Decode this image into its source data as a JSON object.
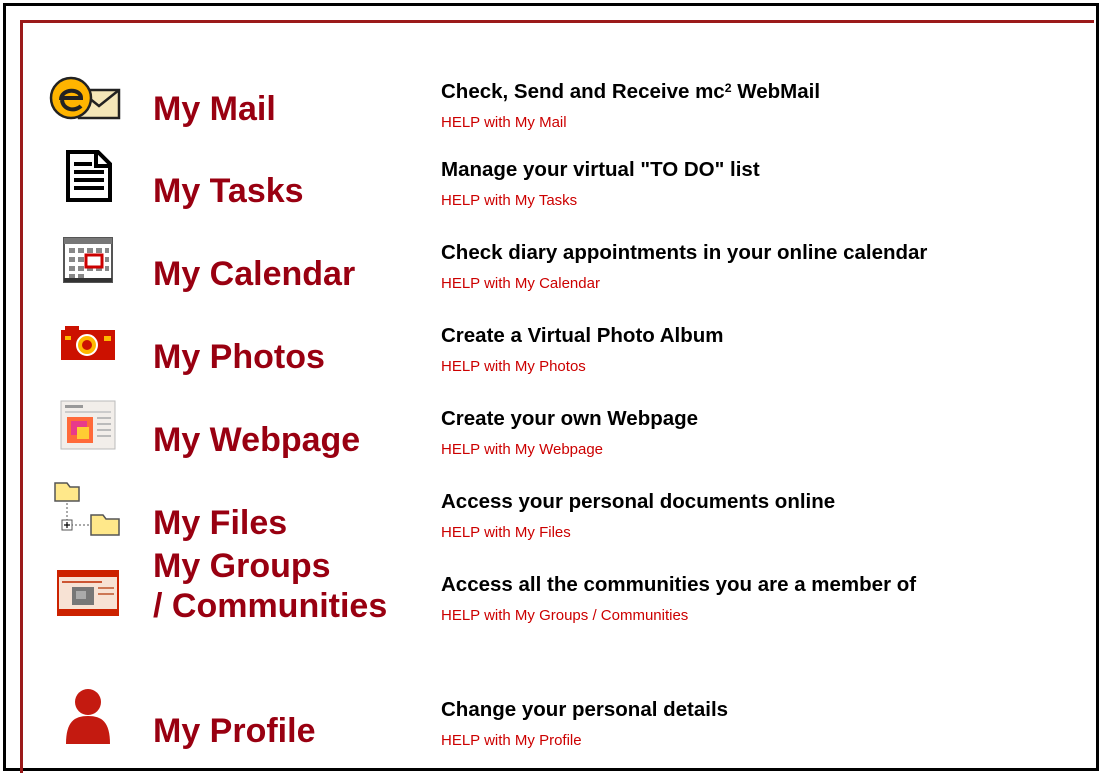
{
  "items": [
    {
      "icon": "mail-icon",
      "title": "My Mail",
      "desc": "Check, Send and Receive mc² WebMail",
      "help": "HELP with My Mail"
    },
    {
      "icon": "tasks-document-icon",
      "title": "My Tasks",
      "desc": "Manage your virtual \"TO DO\" list",
      "help": "HELP with My Tasks"
    },
    {
      "icon": "calendar-icon",
      "title": "My Calendar",
      "desc": "Check diary appointments in your online calendar",
      "help": "HELP with My Calendar"
    },
    {
      "icon": "camera-icon",
      "title": "My Photos",
      "desc": "Create a Virtual Photo Album",
      "help": "HELP with My Photos"
    },
    {
      "icon": "webpage-icon",
      "title": "My Webpage",
      "desc": "Create your own Webpage",
      "help": "HELP with My Webpage"
    },
    {
      "icon": "folder-tree-icon",
      "title": "My Files",
      "desc": "Access your personal documents online",
      "help": "HELP with My Files"
    },
    {
      "icon": "groups-window-icon",
      "title_line1": "My Groups",
      "title_line2": "/ Communities",
      "desc": "Access all the communities you are a member of",
      "help": "HELP with My Groups / Communities"
    },
    {
      "icon": "profile-person-icon",
      "title": "My Profile",
      "desc": "Change your personal details",
      "help": "HELP with My Profile"
    }
  ],
  "colors": {
    "title": "#990011",
    "help": "#cc0000",
    "desc": "#000000",
    "panel_border": "#9b1a1a",
    "outer_border": "#000000"
  }
}
